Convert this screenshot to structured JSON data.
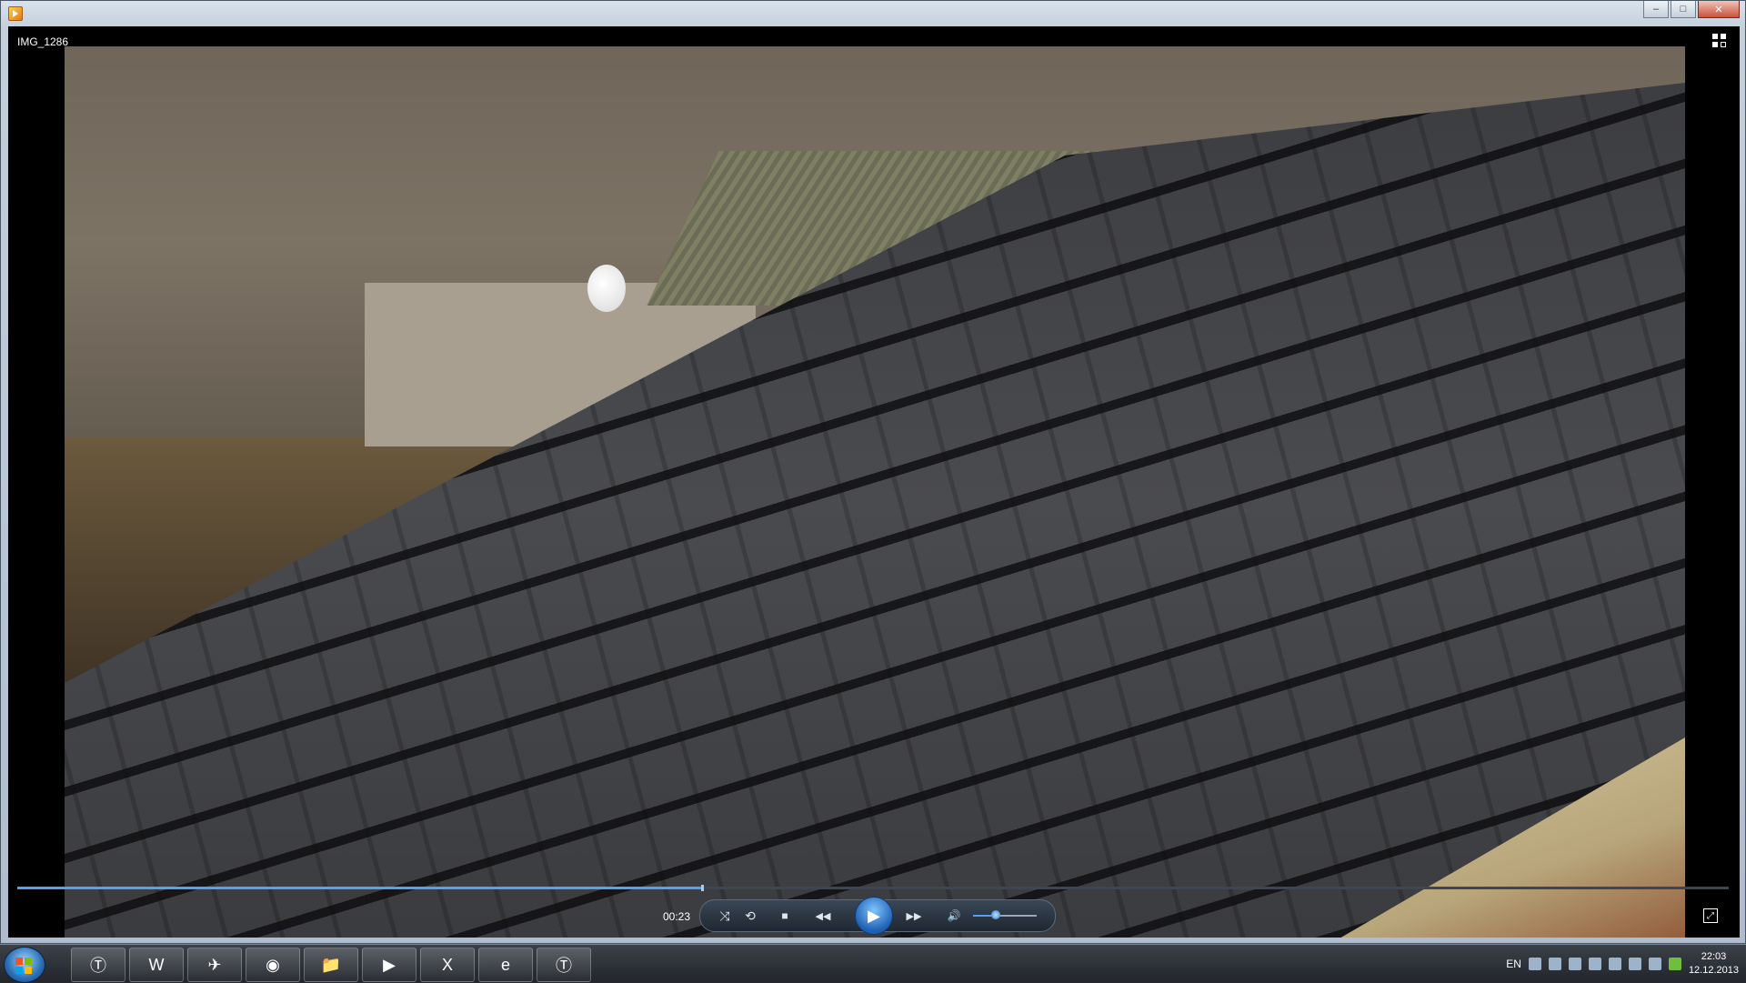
{
  "window": {
    "caption_buttons": {
      "minimize": "–",
      "maximize": "□",
      "close": "✕"
    }
  },
  "video": {
    "title": "IMG_1286",
    "timecode": "00:23",
    "progress_fraction": 0.4,
    "volume_fraction": 0.35
  },
  "controls": {
    "shuffle": "⤨",
    "repeat": "⟲",
    "stop": "■",
    "prev": "◀◀",
    "play": "▶",
    "next": "▶▶",
    "mute": "🔊"
  },
  "taskbar": {
    "apps": [
      {
        "name": "world-of-tanks",
        "glyph": "Ⓣ"
      },
      {
        "name": "word",
        "glyph": "W"
      },
      {
        "name": "aircraft",
        "glyph": "✈"
      },
      {
        "name": "chrome",
        "glyph": "◉"
      },
      {
        "name": "explorer",
        "glyph": "📁"
      },
      {
        "name": "media-player",
        "glyph": "▶"
      },
      {
        "name": "excel",
        "glyph": "X"
      },
      {
        "name": "internet-explorer",
        "glyph": "e"
      },
      {
        "name": "world-of-tanks-2",
        "glyph": "Ⓣ"
      }
    ],
    "tray": {
      "language": "EN",
      "time": "22:03",
      "date": "12.12.2013"
    }
  }
}
